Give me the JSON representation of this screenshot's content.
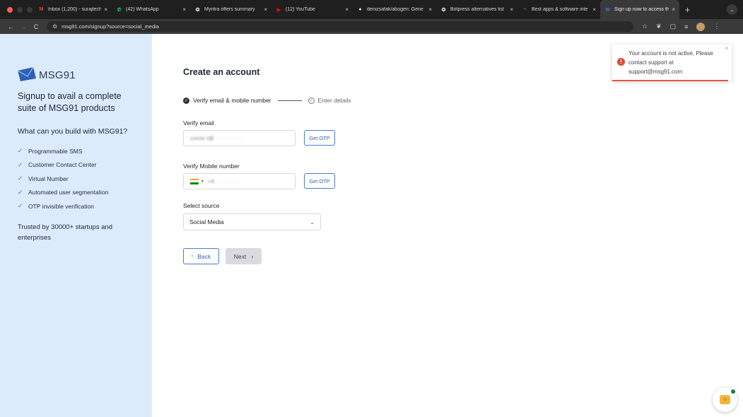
{
  "browser": {
    "tabs": [
      {
        "label": "Inbox (1,200) - surajtech:",
        "icon": "gmail-icon",
        "icon_glyph": "M",
        "icon_color": "#ea4335",
        "active": false
      },
      {
        "label": "(42) WhatsApp",
        "icon": "whatsapp-icon",
        "icon_glyph": "✆",
        "icon_color": "#25d366",
        "active": false
      },
      {
        "label": "Myntra offers summary",
        "icon": "chatgpt-icon",
        "icon_glyph": "❂",
        "icon_color": "#d0d0d0",
        "active": false
      },
      {
        "label": "(12) YouTube",
        "icon": "youtube-icon",
        "icon_glyph": "▶",
        "icon_color": "#ff0000",
        "active": false
      },
      {
        "label": "denizsafak/abogen: Gene",
        "icon": "github-icon",
        "icon_glyph": "●",
        "icon_color": "#e6e6e6",
        "active": false
      },
      {
        "label": "Botpress alternatives list",
        "icon": "chatgpt-icon",
        "icon_glyph": "❂",
        "icon_color": "#d0d0d0",
        "active": false
      },
      {
        "label": "Best apps & software inte",
        "icon": "g2-icon",
        "icon_glyph": "~",
        "icon_color": "#ff492c",
        "active": false
      },
      {
        "label": "Sign up now to access th",
        "icon": "msg91-icon",
        "icon_glyph": "✉",
        "icon_color": "#2f7ce0",
        "active": true
      }
    ],
    "new_tab": "+",
    "tab_menu": "⌄",
    "url": "msg91.com/signup?source=social_media"
  },
  "sidebar": {
    "logo_text": "MSG91",
    "tagline": "Signup to avail a complete suite of MSG91 products",
    "question": "What can you build with MSG91?",
    "features": [
      "Programmable SMS",
      "Customer Contact Center",
      "Virtual Number",
      "Automated user segmentation",
      "OTP invisible verification"
    ],
    "trusted": "Trusted by 30000+ startups and enterprises"
  },
  "form": {
    "title": "Create an account",
    "steps": [
      {
        "label": "Verify email & mobile number",
        "status": "done"
      },
      {
        "label": "Enter details",
        "status": "pending"
      }
    ],
    "email_label": "Verify email",
    "email_value": "conta  t@ ·  ·  ·  ·  ·  · ·",
    "email_otp": "Get OTP",
    "mobile_label": "Verify Mobile number",
    "mobile_value": "+9   ·  ·  ·  ·  ·  ·",
    "mobile_otp": "Get OTP",
    "source_label": "Select source",
    "source_value": "Social Media",
    "back_label": "Back",
    "next_label": "Next"
  },
  "toast": {
    "message": "Your account is not active, Please contact support at support@msg91.com",
    "type": "error",
    "color": "#e45545"
  },
  "colors": {
    "sidebar_bg": "#dcebfb",
    "accent": "#2f5fb6"
  }
}
